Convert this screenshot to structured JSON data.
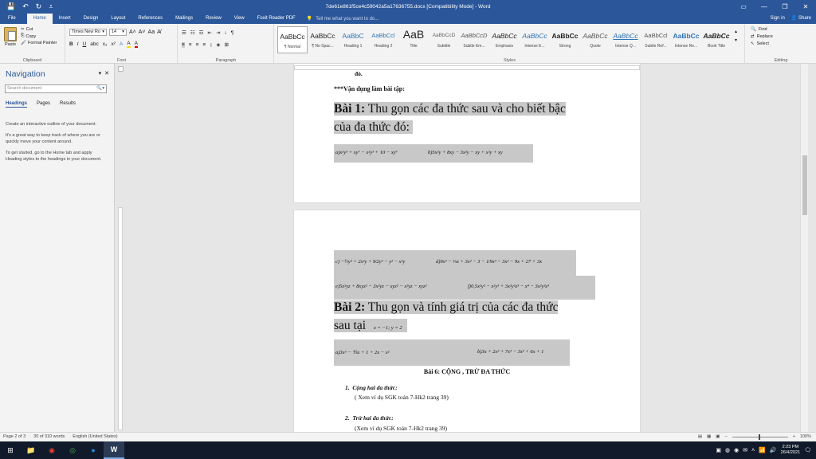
{
  "window": {
    "title": "7de61e861f5ce4c59042a5a17636755.docx [Compatibility Mode] - Word",
    "controls": [
      "▭",
      "—",
      "❐",
      "✕"
    ]
  },
  "qat": {
    "save_icon": "💾",
    "undo_icon": "↶",
    "redo_icon": "↻",
    "more_icon": "⩡"
  },
  "tabs": {
    "file": "File",
    "items": [
      "Home",
      "Insert",
      "Design",
      "Layout",
      "References",
      "Mailings",
      "Review",
      "View",
      "Foxit Reader PDF"
    ],
    "tell_me": "Tell me what you want to do...",
    "sign_in": "Sign in",
    "share": "Share"
  },
  "ribbon": {
    "clipboard": {
      "paste": "Paste",
      "cut": "Cut",
      "copy": "Copy",
      "format_painter": "Format Painter",
      "label": "Clipboard"
    },
    "font": {
      "name": "Times New Ro",
      "size": "14",
      "label": "Font",
      "b": "B",
      "i": "I",
      "u": "U",
      "grow": "A˄",
      "shrink": "A˅",
      "case": "Aa",
      "clear": "A̸",
      "highlight": "A",
      "color": "A"
    },
    "paragraph": {
      "label": "Paragraph"
    },
    "styles": {
      "label": "Styles",
      "items": [
        {
          "sample": "AaBbCc",
          "name": "¶ Normal"
        },
        {
          "sample": "AaBbCc",
          "name": "¶ No Spac..."
        },
        {
          "sample": "AaBbC",
          "name": "Heading 1"
        },
        {
          "sample": "AaBbCcl",
          "name": "Heading 2"
        },
        {
          "sample": "AaB",
          "name": "Title"
        },
        {
          "sample": "AaBbCcD",
          "name": "Subtitle"
        },
        {
          "sample": "AaBbCcD",
          "name": "Subtle Em..."
        },
        {
          "sample": "AaBbCc",
          "name": "Emphasis"
        },
        {
          "sample": "AaBbCc",
          "name": "Intense E..."
        },
        {
          "sample": "AaBbCc",
          "name": "Strong"
        },
        {
          "sample": "AaBbCc",
          "name": "Quote"
        },
        {
          "sample": "AaBbCc",
          "name": "Intense Q..."
        },
        {
          "sample": "AaBbCcl",
          "name": "Subtle Ref..."
        },
        {
          "sample": "AaBbCc",
          "name": "Intense Re..."
        },
        {
          "sample": "AaBbCc",
          "name": "Book Title"
        }
      ]
    },
    "editing": {
      "find": "Find",
      "replace": "Replace",
      "select": "Select",
      "label": "Editing"
    }
  },
  "navigation": {
    "title": "Navigation",
    "search_placeholder": "Search document",
    "tabs": [
      "Headings",
      "Pages",
      "Results"
    ],
    "help": [
      "Create an interactive outline of your document.",
      "It's a great way to keep track of where you are or quickly move your content around.",
      "To get started, go to the Home tab and apply Heading styles to the headings in your document."
    ]
  },
  "document": {
    "page1": {
      "cut_top": "đó.",
      "intro": "***Vận dụng làm bài tập:",
      "bai1_bold": "Bài 1:",
      "bai1_text": "Thu gọn các đa thức sau và cho biết bậc",
      "bai1_text2": "của đa thức đó:",
      "formula_a": "a)x²y³ + xy⁷ − x²y³ + 10 − xy⁷",
      "formula_b": "b)5x²y + 8xy − 3x²y − xy + x²y + xy"
    },
    "page2": {
      "formula_c": "c) −½y² + 2x²y + 9⁄2y² − y² − x²y",
      "formula_d": "d)9x³ − ⅓x + 3x² − 3 − 1⁄9x³ − 3x² − 9x + 27 + 3x",
      "formula_e": "e)5x²yz + 8xyz² − 3x²yz − xyz² − x²yz − xyz²",
      "formula_f": "f)0,5x²y² − x²y³ + 3x²y²z³ − x⁴ − 3x²y²z³",
      "bai2_bold": "Bài 2:",
      "bai2_text": "Thu gọn và tính giá trị của các đa thức",
      "bai2_text2": "sau tại",
      "bai2_cond": "x = −1; y = 2",
      "formula_2a": "a)3x³ − ⅕x + 1 + 2x − x²",
      "formula_2b": "b)3x + 2x² + 7x³ − 3x² + 6x + 1",
      "bai6_title": "Bài 6: CỘNG , TRỪ ĐA THỨC",
      "item1_num": "1.",
      "item1_title": "Cộng hai đa thức:",
      "item1_note": "( Xem ví dụ SGK toán 7-Hk2 trang 39)",
      "item2_num": "2.",
      "item2_title": "Trừ hai đa thức:",
      "item2_note": "(Xem ví dụ SGK toán 7-Hk2 trang 39)"
    }
  },
  "status": {
    "page": "Page 2 of 3",
    "words": "30 of 310 words",
    "language": "English (United States)",
    "zoom": "100%"
  },
  "taskbar": {
    "time": "2:23 PM",
    "date": "26/4/2021"
  }
}
